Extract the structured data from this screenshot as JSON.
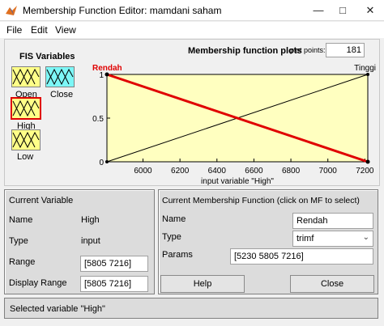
{
  "window": {
    "title": "Membership Function Editor: mamdani saham"
  },
  "menu": {
    "items": [
      "File",
      "Edit",
      "View"
    ]
  },
  "fis_variables": {
    "title": "FIS Variables",
    "items": [
      {
        "label": "Open",
        "color": "#ffff88"
      },
      {
        "label": "Close",
        "color": "#7df7f7"
      },
      {
        "label": "High",
        "color": "#ffff88",
        "selected": true
      },
      {
        "label": "Low",
        "color": "#ffff88"
      }
    ]
  },
  "plot": {
    "title": "Membership function plots",
    "plot_points_label": "plot points:",
    "plot_points_value": "181",
    "xlabel": "input variable \"High\"",
    "mf_labels": {
      "left": "Rendah",
      "right": "Tinggi"
    },
    "colors": {
      "background": "#ffffc0",
      "selected_mf": "#e00000",
      "other_mf": "#000000"
    }
  },
  "chart_data": {
    "type": "line",
    "xlabel": "input variable \"High\"",
    "xlim": [
      5805,
      7216
    ],
    "ylim": [
      0,
      1
    ],
    "x_ticks": [
      6000,
      6200,
      6400,
      6600,
      6800,
      7000,
      7200
    ],
    "y_ticks": [
      0,
      0.5,
      1
    ],
    "series": [
      {
        "name": "Rendah",
        "x": [
          5805,
          7216
        ],
        "y": [
          1,
          0
        ]
      },
      {
        "name": "Tinggi",
        "x": [
          5805,
          7216
        ],
        "y": [
          0,
          1
        ]
      }
    ]
  },
  "current_variable": {
    "title": "Current Variable",
    "name_label": "Name",
    "name_value": "High",
    "type_label": "Type",
    "type_value": "input",
    "range_label": "Range",
    "range_value": "[5805 7216]",
    "display_range_label": "Display Range",
    "display_range_value": "[5805 7216]"
  },
  "current_mf": {
    "title": "Current Membership Function (click on MF to select)",
    "name_label": "Name",
    "name_value": "Rendah",
    "type_label": "Type",
    "type_value": "trimf",
    "params_label": "Params",
    "params_value": "[5230 5805 7216]"
  },
  "buttons": {
    "help": "Help",
    "close": "Close"
  },
  "status": {
    "text": "Selected variable \"High\""
  }
}
